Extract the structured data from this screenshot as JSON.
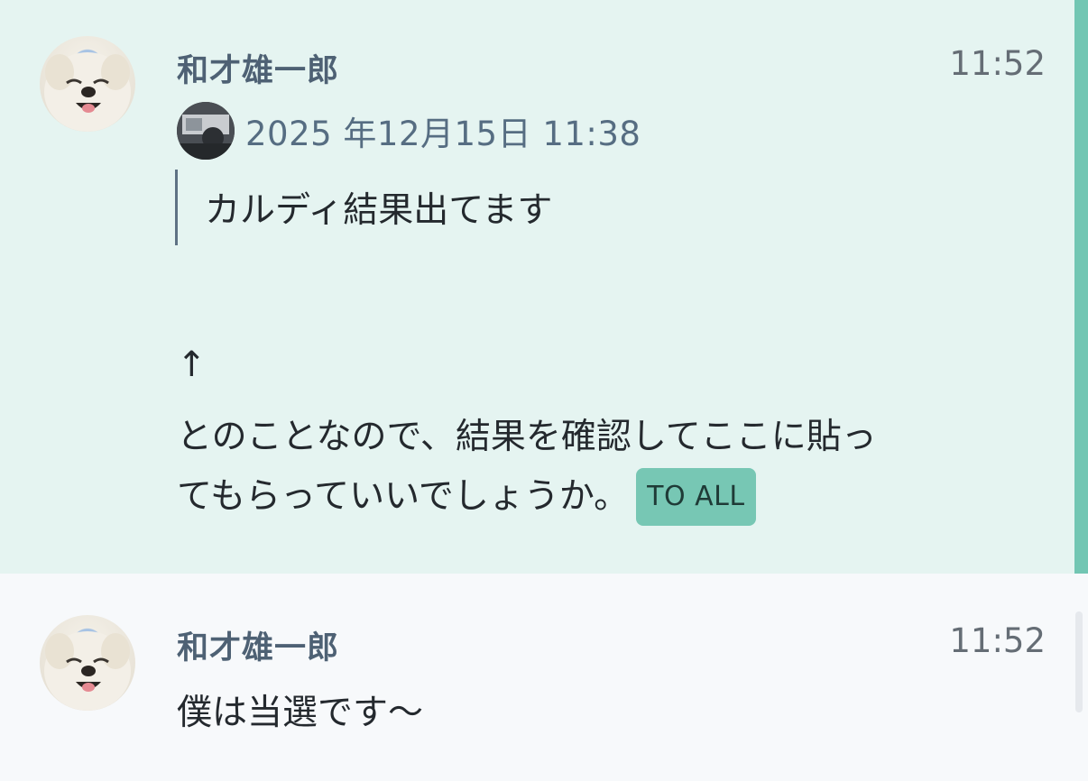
{
  "messages": [
    {
      "sender": "和才雄一郎",
      "time": "11:52",
      "avatar_icon": "dog-avatar",
      "highlighted": true,
      "quote": {
        "date": "2025 年12月15日 11:38",
        "avatar_icon": "person-avatar",
        "text": "カルディ結果出てます"
      },
      "body_lines": [
        "↑",
        "とのことなので、結果を確認してここに貼っ",
        "てもらっていいでしょうか。"
      ],
      "badge": "TO ALL"
    },
    {
      "sender": "和才雄一郎",
      "time": "11:52",
      "avatar_icon": "dog-avatar",
      "highlighted": false,
      "body_lines": [
        "僕は当選です～"
      ]
    }
  ],
  "colors": {
    "highlight_background": "#e5f4f1",
    "highlight_bar": "#72c6b3",
    "badge_background": "#77c7b4",
    "sender_name": "#4e6174",
    "page_background": "#f7f9fb"
  }
}
